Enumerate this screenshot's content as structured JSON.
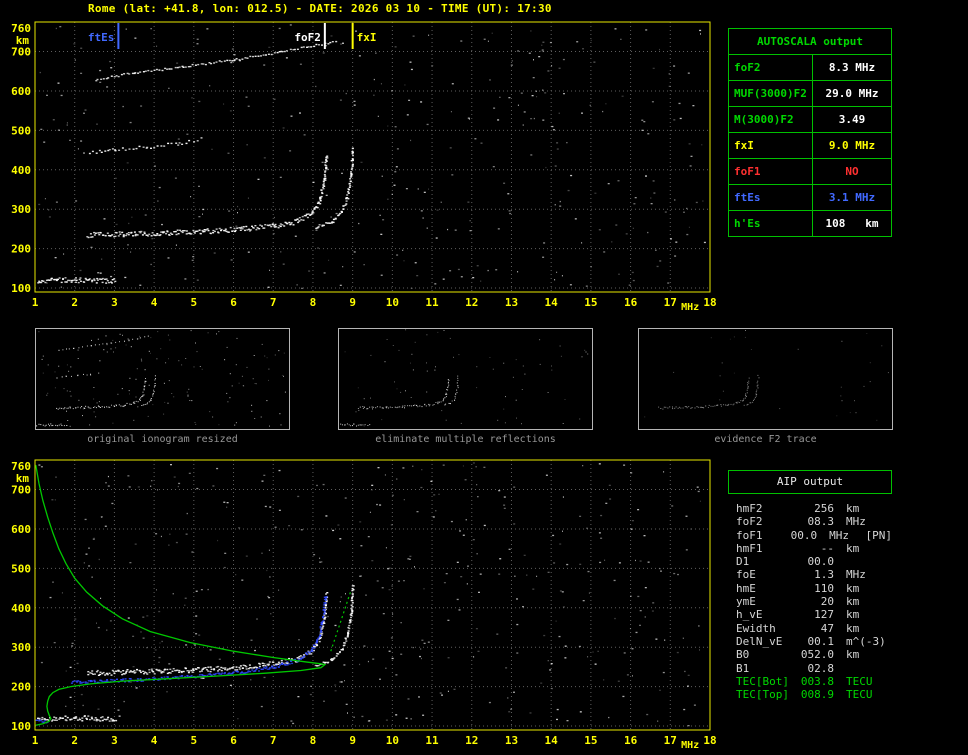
{
  "title": "Rome (lat: +41.8, lon: 012.5) - DATE: 2026 03 10 - TIME (UT): 17:30",
  "colors": {
    "bg": "#000000",
    "axis_yellow": "#ffff00",
    "grid_gray": "#5e5e5e",
    "trace_white": "#ffffff",
    "profile_green": "#00c800",
    "fitted_blue": "#2e46ff",
    "table_green": "#00c000",
    "red": "#ff3030",
    "marker_blue": "#4169ff",
    "caption_gray": "#989898"
  },
  "autoscala": {
    "header": "AUTOSCALA output",
    "rows": [
      {
        "label": "foF2",
        "label_color": "#00d800",
        "value": "8.3 MHz",
        "value_color": "#ffffff"
      },
      {
        "label": "MUF(3000)F2",
        "label_color": "#00d800",
        "value": "29.0 MHz",
        "value_color": "#ffffff"
      },
      {
        "label": "M(3000)F2",
        "label_color": "#00d800",
        "value": "3.49",
        "value_color": "#ffffff"
      },
      {
        "label": "fxI",
        "label_color": "#ffff00",
        "value": "9.0 MHz",
        "value_color": "#ffff00"
      },
      {
        "label": "foF1",
        "label_color": "#ff3030",
        "value": "NO",
        "value_color": "#ff3030"
      },
      {
        "label": "ftEs",
        "label_color": "#4169ff",
        "value": "3.1 MHz",
        "value_color": "#4169ff"
      },
      {
        "label": "h'Es",
        "label_color": "#00d800",
        "value": "108   km",
        "value_color": "#ffffff"
      }
    ]
  },
  "aip": {
    "header": "AIP output",
    "rows": [
      {
        "name": "hmF2",
        "value": "256",
        "unit": "km",
        "extra": ""
      },
      {
        "name": "foF2",
        "value": "08.3",
        "unit": "MHz",
        "extra": ""
      },
      {
        "name": "foF1",
        "value": "00.0",
        "unit": "MHz",
        "extra": "[PN]"
      },
      {
        "name": "hmF1",
        "value": "--",
        "unit": "km",
        "extra": ""
      },
      {
        "name": "D1",
        "value": "00.0",
        "unit": "",
        "extra": ""
      },
      {
        "name": "foE",
        "value": "1.3",
        "unit": "MHz",
        "extra": ""
      },
      {
        "name": "hmE",
        "value": "110",
        "unit": "km",
        "extra": ""
      },
      {
        "name": "ymE",
        "value": "20",
        "unit": "km",
        "extra": ""
      },
      {
        "name": "h_vE",
        "value": "127",
        "unit": "km",
        "extra": ""
      },
      {
        "name": "Ewidth",
        "value": "47",
        "unit": "km",
        "extra": ""
      },
      {
        "name": "DelN_vE",
        "value": "00.1",
        "unit": "m^(-3)",
        "extra": ""
      },
      {
        "name": "B0",
        "value": "052.0",
        "unit": "km",
        "extra": ""
      },
      {
        "name": "B1",
        "value": "02.8",
        "unit": "",
        "extra": ""
      },
      {
        "name": "TEC[Bot]",
        "value": "003.8",
        "unit": "TECU",
        "extra": "",
        "row_color": "#00d800"
      },
      {
        "name": "TEC[Top]",
        "value": "008.9",
        "unit": "TECU",
        "extra": "",
        "row_color": "#00d800"
      }
    ]
  },
  "thumbnails": [
    {
      "caption": "original ionogram resized",
      "noise": 150,
      "alpha": 1.0,
      "trace_idxs": [
        0,
        1,
        2,
        3,
        4
      ]
    },
    {
      "caption": "eliminate multiple reflections",
      "noise": 70,
      "alpha": 0.85,
      "trace_idxs": [
        0,
        1,
        2
      ]
    },
    {
      "caption": "evidence F2 trace",
      "noise": 30,
      "alpha": 0.6,
      "trace_idxs": [
        1,
        2
      ]
    }
  ],
  "chart_data": [
    {
      "id": "top-ionogram",
      "type": "scatter",
      "title": "scaled ionogram with AUTOSCALA characteristic markers",
      "xlabel": "MHz",
      "ylabel": "km",
      "xlim": [
        1,
        18
      ],
      "ylim_km": [
        90,
        775
      ],
      "x_ticks": [
        1,
        2,
        3,
        4,
        5,
        6,
        7,
        8,
        9,
        10,
        11,
        12,
        13,
        14,
        15,
        16,
        17,
        18
      ],
      "y_ticks": [
        760,
        700,
        600,
        500,
        400,
        300,
        200,
        100
      ],
      "grid": true,
      "noise": 380,
      "markers": [
        {
          "label": "ftEs",
          "freq": 3.1,
          "color": "#4169ff",
          "side": "left"
        },
        {
          "label": "foF2",
          "freq": 8.3,
          "color": "#ffffff",
          "side": "left"
        },
        {
          "label": "fxI",
          "freq": 9.0,
          "color": "#ffff00",
          "side": "right"
        }
      ],
      "traces": [
        {
          "name": "Es-trace",
          "points": [
            [
              1.05,
              120
            ],
            [
              2.0,
              122
            ],
            [
              3.0,
              119
            ]
          ],
          "thickness": 5,
          "step": 1.2,
          "color": "#ffffff"
        },
        {
          "name": "F2-ordinary",
          "points": [
            [
              2.3,
              236
            ],
            [
              3.2,
              238
            ],
            [
              4.2,
              241
            ],
            [
              5.2,
              245
            ],
            [
              6.2,
              251
            ],
            [
              7.0,
              259
            ],
            [
              7.6,
              271
            ],
            [
              7.95,
              292
            ],
            [
              8.15,
              322
            ],
            [
              8.28,
              380
            ],
            [
              8.32,
              438
            ]
          ],
          "thickness": 5,
          "step": 1.2,
          "color": "#ffffff"
        },
        {
          "name": "F2-extraordinary",
          "points": [
            [
              8.05,
              256
            ],
            [
              8.45,
              269
            ],
            [
              8.7,
              293
            ],
            [
              8.85,
              332
            ],
            [
              8.95,
              392
            ],
            [
              8.99,
              458
            ]
          ],
          "thickness": 3,
          "step": 1.4,
          "color": "#ffffff"
        },
        {
          "name": "second-hop-trace",
          "points": [
            [
              2.35,
              445
            ],
            [
              3.0,
              452
            ],
            [
              3.8,
              459
            ],
            [
              4.6,
              468
            ],
            [
              5.15,
              479
            ]
          ],
          "thickness": 3,
          "step": 3.2,
          "color": "#ffffff"
        },
        {
          "name": "upper-multiple",
          "points": [
            [
              2.5,
              630
            ],
            [
              3.5,
              648
            ],
            [
              4.7,
              663
            ],
            [
              6.0,
              681
            ],
            [
              7.2,
              701
            ],
            [
              8.55,
              727
            ]
          ],
          "thickness": 2,
          "step": 2.6,
          "color": "#ffffff"
        }
      ],
      "profiles": []
    },
    {
      "id": "bottom-ionogram",
      "type": "scatter",
      "title": "ionogram with fitted trace and electron density profile",
      "xlabel": "MHz",
      "ylabel": "km",
      "xlim": [
        1,
        18
      ],
      "ylim_km": [
        90,
        775
      ],
      "x_ticks": [
        1,
        2,
        3,
        4,
        5,
        6,
        7,
        8,
        9,
        10,
        11,
        12,
        13,
        14,
        15,
        16,
        17,
        18
      ],
      "y_ticks": [
        760,
        700,
        600,
        500,
        400,
        300,
        200,
        100
      ],
      "grid": true,
      "noise": 420,
      "markers": [],
      "traces": [
        {
          "name": "Es-trace",
          "points": [
            [
              1.05,
              120
            ],
            [
              2.0,
              122
            ],
            [
              3.0,
              119
            ]
          ],
          "thickness": 5,
          "step": 1.2,
          "color": "#ffffff"
        },
        {
          "name": "F2-ordinary",
          "points": [
            [
              2.3,
              236
            ],
            [
              3.2,
              238
            ],
            [
              4.2,
              241
            ],
            [
              5.2,
              245
            ],
            [
              6.2,
              251
            ],
            [
              7.0,
              259
            ],
            [
              7.6,
              271
            ],
            [
              7.95,
              292
            ],
            [
              8.15,
              322
            ],
            [
              8.28,
              380
            ],
            [
              8.32,
              438
            ]
          ],
          "thickness": 5,
          "step": 1.2,
          "color": "#ffffff"
        },
        {
          "name": "F2-extraordinary",
          "points": [
            [
              8.05,
              256
            ],
            [
              8.45,
              269
            ],
            [
              8.7,
              293
            ],
            [
              8.85,
              332
            ],
            [
              8.95,
              392
            ],
            [
              8.99,
              458
            ]
          ],
          "thickness": 3,
          "step": 1.4,
          "color": "#ffffff"
        },
        {
          "name": "fitted-F2-trace",
          "points": [
            [
              1.9,
              213
            ],
            [
              2.8,
              216
            ],
            [
              4.0,
              221
            ],
            [
              5.2,
              229
            ],
            [
              6.2,
              239
            ],
            [
              7.0,
              251
            ],
            [
              7.6,
              269
            ],
            [
              7.95,
              293
            ],
            [
              8.15,
              331
            ],
            [
              8.25,
              386
            ],
            [
              8.3,
              432
            ]
          ],
          "thickness": 3,
          "step": 1.3,
          "color": "#2e46ff"
        },
        {
          "name": "fitted-Es-trace",
          "points": [
            [
              1.0,
              119
            ],
            [
              1.3,
              111
            ]
          ],
          "thickness": 3,
          "step": 1.3,
          "color": "#2e46ff"
        }
      ],
      "profiles": [
        {
          "name": "electron-density-profile",
          "color": "#00c800",
          "width": 1.3,
          "dashed": false,
          "points": [
            [
              1.02,
              762
            ],
            [
              1.1,
              715
            ],
            [
              1.2,
              672
            ],
            [
              1.32,
              630
            ],
            [
              1.45,
              590
            ],
            [
              1.6,
              550
            ],
            [
              1.78,
              512
            ],
            [
              2.0,
              475
            ],
            [
              2.3,
              440
            ],
            [
              2.7,
              405
            ],
            [
              3.2,
              372
            ],
            [
              3.9,
              340
            ],
            [
              4.9,
              312
            ],
            [
              6.0,
              290
            ],
            [
              7.0,
              274
            ],
            [
              7.8,
              263
            ],
            [
              8.2,
              258
            ],
            [
              8.3,
              256
            ],
            [
              8.2,
              248
            ],
            [
              7.7,
              241
            ],
            [
              6.8,
              234
            ],
            [
              5.6,
              227
            ],
            [
              4.3,
              220
            ],
            [
              3.2,
              214
            ],
            [
              2.4,
              207
            ],
            [
              1.9,
              200
            ],
            [
              1.6,
              193
            ],
            [
              1.45,
              185
            ],
            [
              1.36,
              175
            ],
            [
              1.32,
              163
            ],
            [
              1.3,
              150
            ],
            [
              1.32,
              138
            ],
            [
              1.36,
              127
            ],
            [
              1.4,
              119
            ],
            [
              1.35,
              112
            ],
            [
              1.2,
              106
            ],
            [
              1.02,
              102
            ]
          ]
        },
        {
          "name": "topside-extrapolation",
          "color": "#00c800",
          "width": 1.2,
          "dashed": true,
          "points": [
            [
              8.45,
              290
            ],
            [
              8.7,
              365
            ],
            [
              8.95,
              442
            ]
          ]
        }
      ]
    }
  ]
}
